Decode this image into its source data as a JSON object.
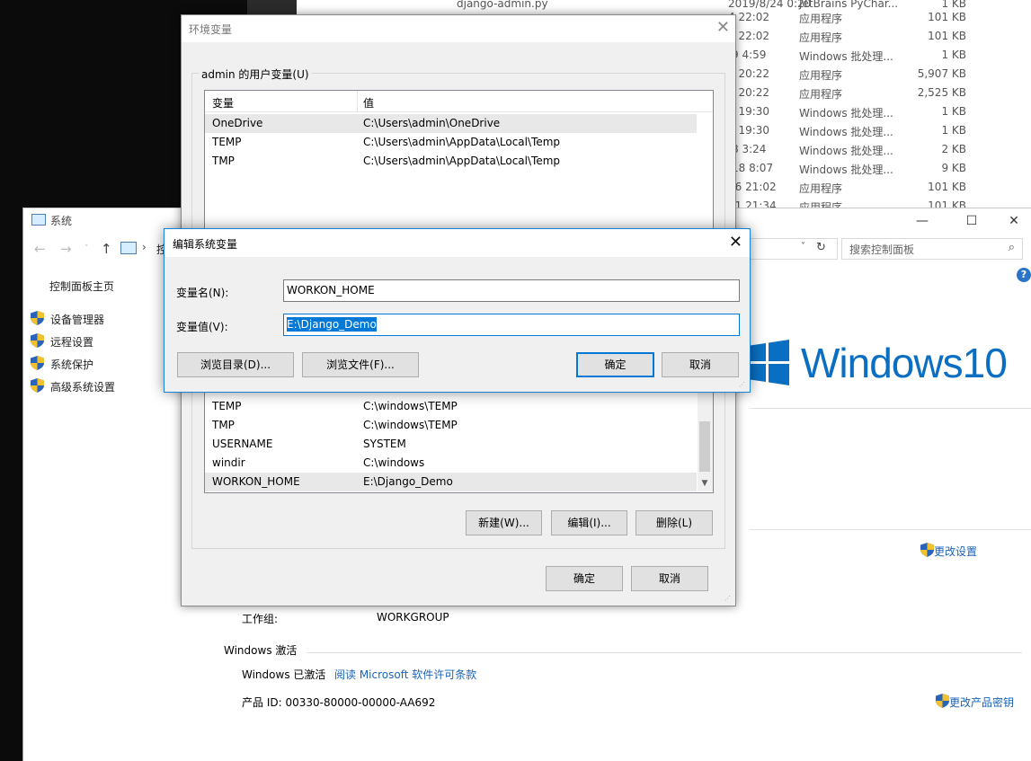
{
  "explorer": {
    "top_filename": "django-admin.py",
    "rows": [
      {
        "date": "2019/8/24 0:20",
        "type": "JetBrains PyChar...",
        "size": "1 KB"
      },
      {
        "date": "4 22:02",
        "type": "应用程序",
        "size": "101 KB"
      },
      {
        "date": "4 22:02",
        "type": "应用程序",
        "size": "101 KB"
      },
      {
        "date": "/9 4:59",
        "type": "Windows 批处理...",
        "size": "1 KB"
      },
      {
        "date": "1 20:22",
        "type": "应用程序",
        "size": "5,907 KB"
      },
      {
        "date": "1 20:22",
        "type": "应用程序",
        "size": "2,525 KB"
      },
      {
        "date": "4 19:30",
        "type": "Windows 批处理...",
        "size": "1 KB"
      },
      {
        "date": "4 19:30",
        "type": "Windows 批处理...",
        "size": "1 KB"
      },
      {
        "date": "/8 3:24",
        "type": "Windows 批处理...",
        "size": "2 KB"
      },
      {
        "date": "/18 8:07",
        "type": "Windows 批处理...",
        "size": "9 KB"
      },
      {
        "date": "26 21:02",
        "type": "应用程序",
        "size": "101 KB"
      },
      {
        "date": "21 21:34",
        "type": "应用程序",
        "size": "101 KB"
      }
    ]
  },
  "system_window": {
    "title": "系统",
    "address_fragment": "控",
    "search_placeholder": "搜索控制面板",
    "help": "?",
    "left_nav": {
      "home": "控制面板主页",
      "items": [
        "设备管理器",
        "远程设置",
        "系统保护",
        "高级系统设置"
      ]
    },
    "windows_logo_text": "Windows10",
    "change_settings": "更改设置",
    "workgroup_label": "工作组:",
    "workgroup_value": "WORKGROUP",
    "activation_section": "Windows 激活",
    "activation_status": "Windows 已激活",
    "license_link": "阅读 Microsoft 软件许可条款",
    "product_id": "产品 ID: 00330-80000-00000-AA692",
    "change_key": "更改产品密钥"
  },
  "env_dialog": {
    "title": "环境变量",
    "user_group_label": "admin 的用户变量(U)",
    "col_var": "变量",
    "col_val": "值",
    "user_vars": [
      {
        "name": "OneDrive",
        "value": "C:\\Users\\admin\\OneDrive"
      },
      {
        "name": "TEMP",
        "value": "C:\\Users\\admin\\AppData\\Local\\Temp"
      },
      {
        "name": "TMP",
        "value": "C:\\Users\\admin\\AppData\\Local\\Temp"
      }
    ],
    "system_vars": [
      {
        "name": "TEMP",
        "value": "C:\\windows\\TEMP"
      },
      {
        "name": "TMP",
        "value": "C:\\windows\\TEMP"
      },
      {
        "name": "USERNAME",
        "value": "SYSTEM"
      },
      {
        "name": "windir",
        "value": "C:\\windows"
      },
      {
        "name": "WORKON_HOME",
        "value": "E:\\Django_Demo"
      }
    ],
    "new_button": "新建(W)...",
    "edit_button": "编辑(I)...",
    "delete_button": "删除(L)",
    "ok_button": "确定",
    "cancel_button": "取消"
  },
  "edit_dialog": {
    "title": "编辑系统变量",
    "name_label": "变量名(N):",
    "value_label": "变量值(V):",
    "name_value": "WORKON_HOME",
    "value_value": "E:\\Django_Demo",
    "browse_dir_button": "浏览目录(D)...",
    "browse_file_button": "浏览文件(F)...",
    "ok_button": "确定",
    "cancel_button": "取消"
  },
  "colors": {
    "accent": "#0078d7",
    "windows_logo": "#0a6fc2",
    "link": "#1a63b8"
  }
}
